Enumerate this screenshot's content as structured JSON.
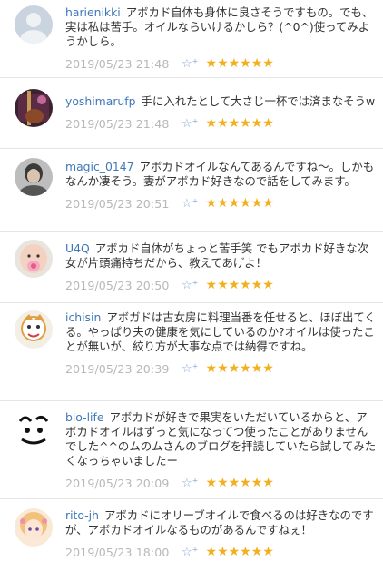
{
  "comments": [
    {
      "user": "harienikki",
      "text": "アボカド自体も身体に良さそうですもの。でも、実は私は苦手。オイルならいけるかしら？(^0^)使ってみようかしら。",
      "timestamp": "2019/05/23 21:48",
      "stars": "★★★★★★",
      "avatar": "default-silhouette-avatar"
    },
    {
      "user": "yoshimarufp",
      "text": "手に入れたとして大さじ一杯では済まなそうw",
      "timestamp": "2019/05/23 21:48",
      "stars": "★★★★★★",
      "avatar": "guitar-photo-avatar"
    },
    {
      "user": "magic_0147",
      "text": "アボカドオイルなんてあるんですね〜。しかもなんか凄そう。妻がアボカド好きなので話をしてみます。",
      "timestamp": "2019/05/23 20:51",
      "stars": "★★★★★★",
      "avatar": "person-photo-avatar"
    },
    {
      "user": "U4Q",
      "text": "アボカド自体がちょっと苦手笑 でもアボカド好きな次女が片頭痛持ちだから、教えてあげよ！",
      "timestamp": "2019/05/23 20:50",
      "stars": "★★★★★★",
      "avatar": "baby-photo-avatar"
    },
    {
      "user": "ichisin",
      "text": "アボガドは古女房に料理当番を任せると、ほぼ出てくる。やっぱり夫の健康を気にしているのか?オイルは使ったことが無いが、絞り方が大事な点では納得ですね。",
      "timestamp": "2019/05/23 20:39",
      "stars": "★★★★★★",
      "avatar": "cartoon-character-avatar"
    },
    {
      "user": "bio-life",
      "text": "アボカドが好きで果実をいただいているからと、アボカドオイルはずっと気になってつ使ったことがありませんでした^^のムのムさんのブログを拝読していたら試してみたくなっちゃいましたー",
      "timestamp": "2019/05/23 20:09",
      "stars": "★★★★★★",
      "avatar": "ink-logo-avatar"
    },
    {
      "user": "rito-jh",
      "text": "アボカドにオリーブオイルで食べるのは好きなのですが、アボカドオイルなるものがあるんですねぇ！",
      "timestamp": "2019/05/23 18:00",
      "stars": "★★★★★★",
      "avatar": "anime-girl-avatar"
    }
  ]
}
